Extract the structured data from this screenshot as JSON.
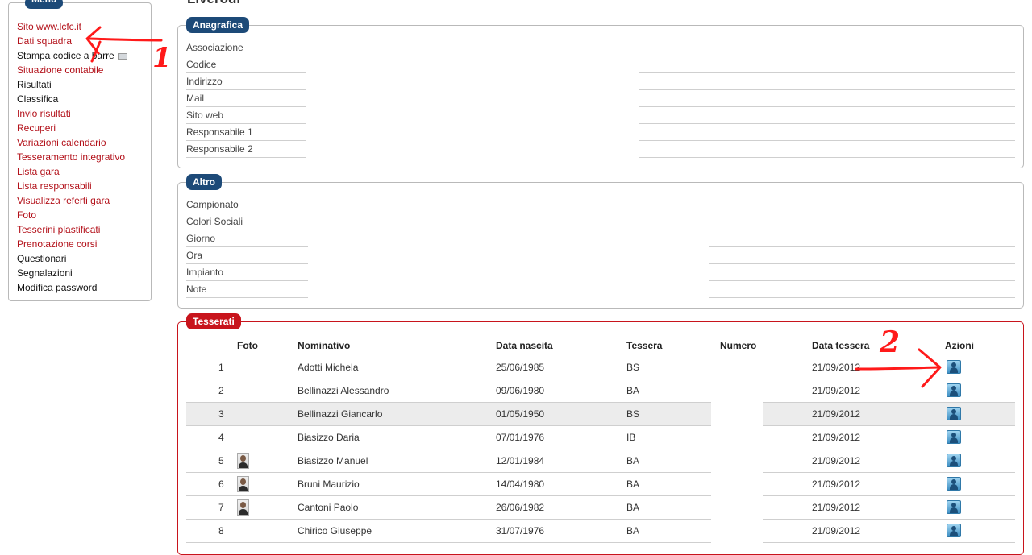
{
  "page": {
    "title": "Liverodi"
  },
  "menu": {
    "legend": "Menu",
    "items": [
      {
        "label": "Sito www.lcfc.it",
        "color": "red"
      },
      {
        "label": "Dati squadra",
        "color": "red"
      },
      {
        "label": "Stampa codice a barre",
        "color": "black",
        "icon": "barcode-icon"
      },
      {
        "label": "Situazione contabile",
        "color": "red"
      },
      {
        "label": "Risultati",
        "color": "black"
      },
      {
        "label": "Classifica",
        "color": "black"
      },
      {
        "label": "Invio risultati",
        "color": "red"
      },
      {
        "label": "Recuperi",
        "color": "red"
      },
      {
        "label": "Variazioni calendario",
        "color": "red"
      },
      {
        "label": "Tesseramento integrativo",
        "color": "red"
      },
      {
        "label": "Lista gara",
        "color": "red"
      },
      {
        "label": "Lista responsabili",
        "color": "red"
      },
      {
        "label": "Visualizza referti gara",
        "color": "red"
      },
      {
        "label": "Foto",
        "color": "red"
      },
      {
        "label": "Tesserini plastificati",
        "color": "red"
      },
      {
        "label": "Prenotazione corsi",
        "color": "red"
      },
      {
        "label": "Questionari",
        "color": "black"
      },
      {
        "label": "Segnalazioni",
        "color": "black"
      },
      {
        "label": "Modifica password",
        "color": "black"
      }
    ]
  },
  "anagrafica": {
    "legend": "Anagrafica",
    "fields": [
      "Associazione",
      "Codice",
      "Indirizzo",
      "Mail",
      "Sito web",
      "Responsabile 1",
      "Responsabile 2"
    ]
  },
  "altro": {
    "legend": "Altro",
    "fields": [
      "Campionato",
      "Colori Sociali",
      "Giorno",
      "Ora",
      "Impianto",
      "Note"
    ]
  },
  "tesserati": {
    "legend": "Tesserati",
    "columns": {
      "foto": "Foto",
      "nominativo": "Nominativo",
      "data_nascita": "Data nascita",
      "tessera": "Tessera",
      "numero": "Numero",
      "data_tessera": "Data tessera",
      "azioni": "Azioni"
    },
    "rows": [
      {
        "n": "1",
        "nominativo": "Adotti Michela",
        "data_nascita": "25/06/1985",
        "tessera": "BS",
        "data_tessera": "21/09/2012",
        "photo": false
      },
      {
        "n": "2",
        "nominativo": "Bellinazzi Alessandro",
        "data_nascita": "09/06/1980",
        "tessera": "BA",
        "data_tessera": "21/09/2012",
        "photo": false
      },
      {
        "n": "3",
        "nominativo": "Bellinazzi Giancarlo",
        "data_nascita": "01/05/1950",
        "tessera": "BS",
        "data_tessera": "21/09/2012",
        "photo": false
      },
      {
        "n": "4",
        "nominativo": "Biasizzo Daria",
        "data_nascita": "07/01/1976",
        "tessera": "IB",
        "data_tessera": "21/09/2012",
        "photo": false
      },
      {
        "n": "5",
        "nominativo": "Biasizzo Manuel",
        "data_nascita": "12/01/1984",
        "tessera": "BA",
        "data_tessera": "21/09/2012",
        "photo": true
      },
      {
        "n": "6",
        "nominativo": "Bruni Maurizio",
        "data_nascita": "14/04/1980",
        "tessera": "BA",
        "data_tessera": "21/09/2012",
        "photo": true
      },
      {
        "n": "7",
        "nominativo": "Cantoni Paolo",
        "data_nascita": "26/06/1982",
        "tessera": "BA",
        "data_tessera": "21/09/2012",
        "photo": true
      },
      {
        "n": "8",
        "nominativo": "Chirico Giuseppe",
        "data_nascita": "31/07/1976",
        "tessera": "BA",
        "data_tessera": "21/09/2012",
        "photo": false
      }
    ]
  },
  "annotations": {
    "one": "1",
    "two": "2",
    "color": "#ff1a1a"
  }
}
